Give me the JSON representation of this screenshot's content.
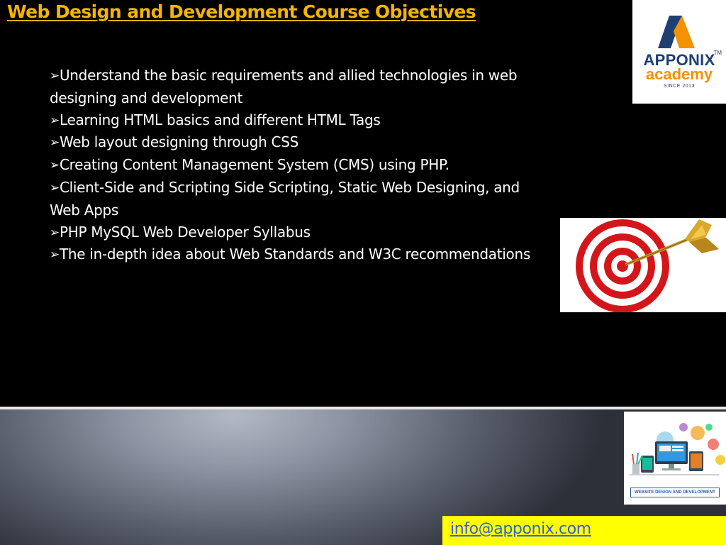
{
  "slide": {
    "title": "Web Design and Development Course Objectives",
    "bullet_marker": "➢",
    "bullets": [
      "Understand the basic requirements and allied technologies in web designing and development",
      "Learning HTML basics and different HTML Tags",
      "Web layout designing through CSS",
      "Creating Content Management System (CMS) using PHP.",
      "Client-Side and Scripting Side Scripting, Static Web Designing, and Web Apps",
      "PHP MySQL Web Developer Syllabus",
      "The in-depth idea about Web Standards and W3C recommendations"
    ]
  },
  "logo": {
    "brand": "APPONIX",
    "tm": "TM",
    "subbrand": "academy",
    "since": "SINCE 2013"
  },
  "web_image": {
    "caption": "WEBSITE DESIGN AND DEVELOPMENT"
  },
  "contact": {
    "email": "info@apponix.com"
  },
  "colors": {
    "title": "#f5b400",
    "background": "#000000",
    "email_box": "#ffff00",
    "link": "#2f63d3"
  },
  "icons": {
    "bullet": "arrow-bullet-icon",
    "logo_mark": "apponix-a-logo-icon",
    "target": "target-dart-icon"
  }
}
